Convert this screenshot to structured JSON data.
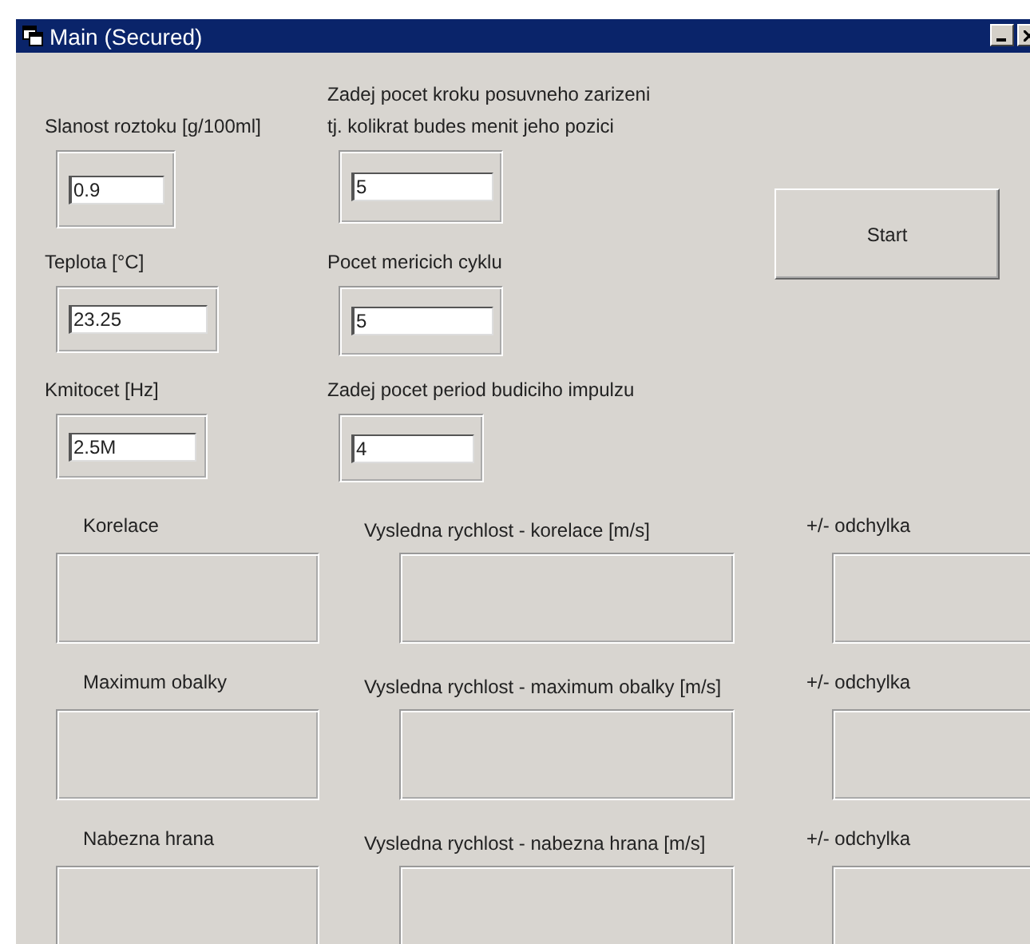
{
  "window": {
    "title": "Main (Secured)"
  },
  "input_columns": [
    [
      {
        "label": "Slanost roztoku [g/100ml]",
        "value": "0.9"
      },
      {
        "label": "Teplota [°C]",
        "value": "23.25"
      },
      {
        "label": "Kmitocet [Hz]",
        "value": "2.5M"
      }
    ],
    [
      {
        "label": "Zadej pocet kroku posuvneho zarizeni\ntj. kolikrat budes menit jeho pozici",
        "value": "5"
      },
      {
        "label": "Pocet mericich cyklu",
        "value": "5"
      },
      {
        "label": "Zadej pocet period budiciho impulzu",
        "value": "4"
      }
    ]
  ],
  "start_button": "Start",
  "results": [
    {
      "method": "Korelace",
      "speed_label": "Vysledna rychlost - korelace [m/s]",
      "deviation_label": "+/- odchylka"
    },
    {
      "method": "Maximum obalky",
      "speed_label": "Vysledna rychlost - maximum obalky [m/s]",
      "deviation_label": "+/- odchylka"
    },
    {
      "method": "Nabezna hrana",
      "speed_label": "Vysledna rychlost - nabezna hrana [m/s]",
      "deviation_label": "+/- odchylka"
    }
  ]
}
